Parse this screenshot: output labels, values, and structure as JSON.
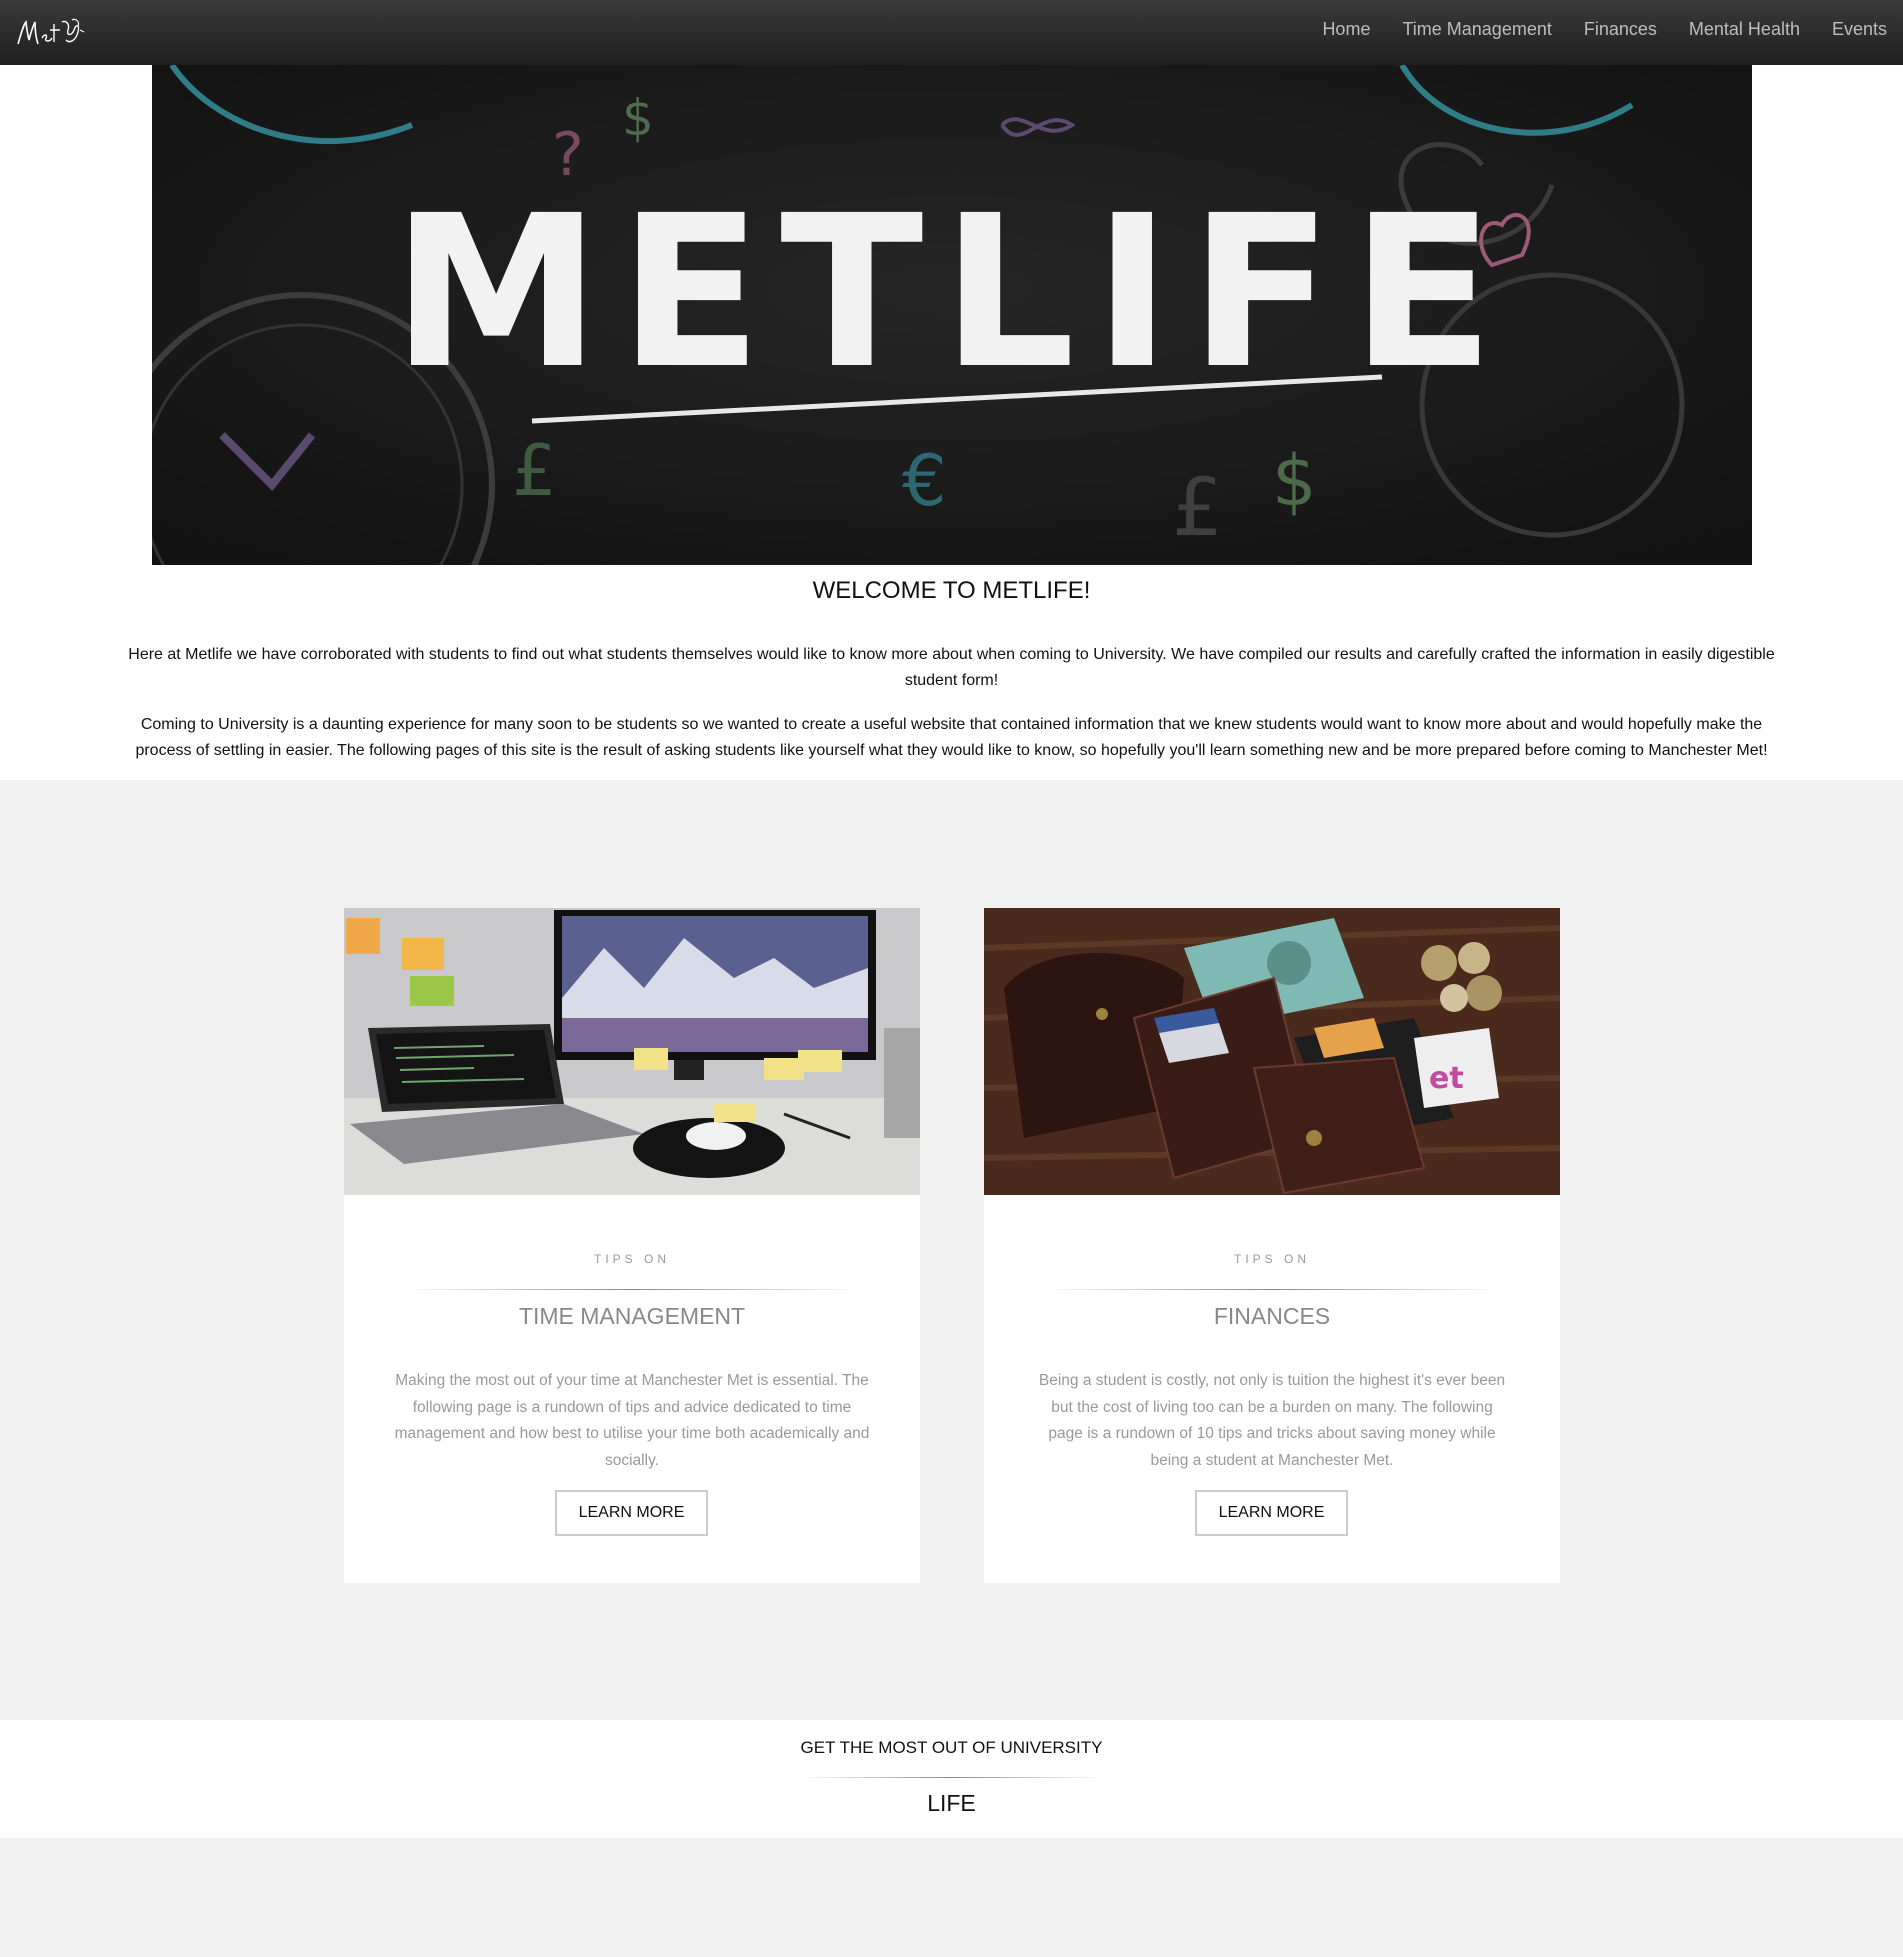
{
  "nav": {
    "logo_text": "Metlife",
    "items": [
      "Home",
      "Time Management",
      "Finances",
      "Mental Health",
      "Events"
    ]
  },
  "hero": {
    "banner_text": "METLIFE"
  },
  "welcome": {
    "title": "WELCOME TO METLIFE!",
    "paragraphs": [
      "Here at Metlife we have corroborated with students to find out what students themselves would like to know more about when coming to University. We have compiled our results and carefully crafted the information in easily digestible student form!",
      "Coming to University is a daunting experience for many soon to be students so we wanted to create a useful website that contained information that we knew students would want to know more about and would hopefully make the process of settling in easier. The following pages of this site is the result of asking students like yourself what they would like to know, so hopefully you'll learn something new and be more prepared before coming to Manchester Met!"
    ]
  },
  "cards": [
    {
      "eyebrow": "TIPS ON",
      "title": "TIME MANAGEMENT",
      "text": "Making the most out of your time at Manchester Met is essential. The following page is a rundown of tips and advice dedicated to time management and how best to utilise your time both academically and socially.",
      "button": "LEARN MORE"
    },
    {
      "eyebrow": "TIPS ON",
      "title": "FINANCES",
      "text": "Being a student is costly, not only is tuition the highest it's ever been but the cost of living too can be a burden on many. The following page is a rundown of 10 tips and tricks about saving money while being a student at Manchester Met.",
      "button": "LEARN MORE"
    }
  ],
  "band": {
    "subtitle": "GET THE MOST OUT OF UNIVERSITY",
    "title": "LIFE"
  }
}
